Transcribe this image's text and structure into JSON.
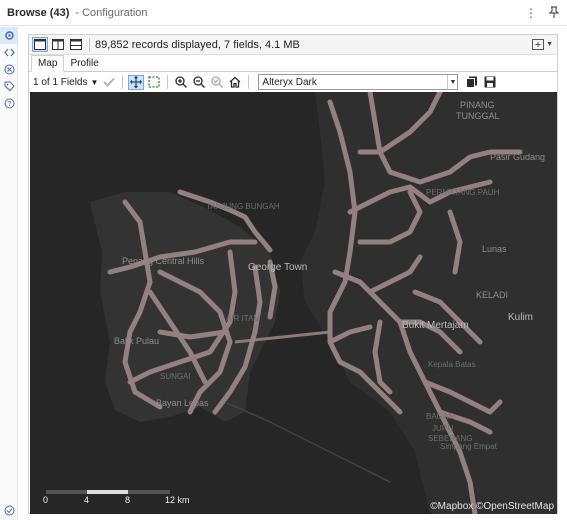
{
  "window": {
    "title": "Browse (43)",
    "subtitle": "- Configuration",
    "more_icon": "more-vertical-icon",
    "pin_icon": "pin-icon"
  },
  "left_rail": {
    "items": [
      {
        "name": "gear-icon"
      },
      {
        "name": "code-icon"
      },
      {
        "name": "x-circle-icon"
      },
      {
        "name": "tag-icon"
      },
      {
        "name": "help-icon"
      }
    ],
    "bottom_icon": "check-circle-icon"
  },
  "toolbar": {
    "records_text": "89,852 records displayed, 7 fields, 4.1 MB"
  },
  "tabs": [
    {
      "label": "Map",
      "active": true
    },
    {
      "label": "Profile",
      "active": false
    }
  ],
  "map_toolbar": {
    "fields_selector": "1 of 1 Fields",
    "theme": "Alteryx Dark"
  },
  "map": {
    "labels": {
      "pinang_tunggal_1": "PINANG",
      "pinang_tunggal_2": "TUNGGAL",
      "penang_central_hills": "Penang Central Hills",
      "george_town": "George Town",
      "lunas": "Lunas",
      "keladi": "KELADI",
      "kulim": "Kulim",
      "bukit_mertajam": "Bukit Mertajam",
      "pasir_gudang": "Pasir Gudang",
      "tanjung_bungah": "TANJUNG BUNGAH",
      "air_itam": "AIR ITAM",
      "balik_pulau": "Balik Pulau",
      "bayan_lepas": "Bayan Lepas",
      "permatang_pauh": "PERMATANG PAUH",
      "kepala_batas": "Kepala Batas",
      "simpang_empat": "Simpang Empat",
      "sungai": "SUNGAI",
      "bagan": "BAGAN",
      "juru": "JURU",
      "seberang": "SEBERANG"
    },
    "scale_labels": [
      "0",
      "4",
      "8",
      "12 km"
    ],
    "attribution": "©Mapbox ©OpenStreetMap",
    "colors": {
      "background": "#262626",
      "land": "#2f2f2f",
      "water": "#1a1a1a",
      "route": "#9a8585"
    }
  }
}
